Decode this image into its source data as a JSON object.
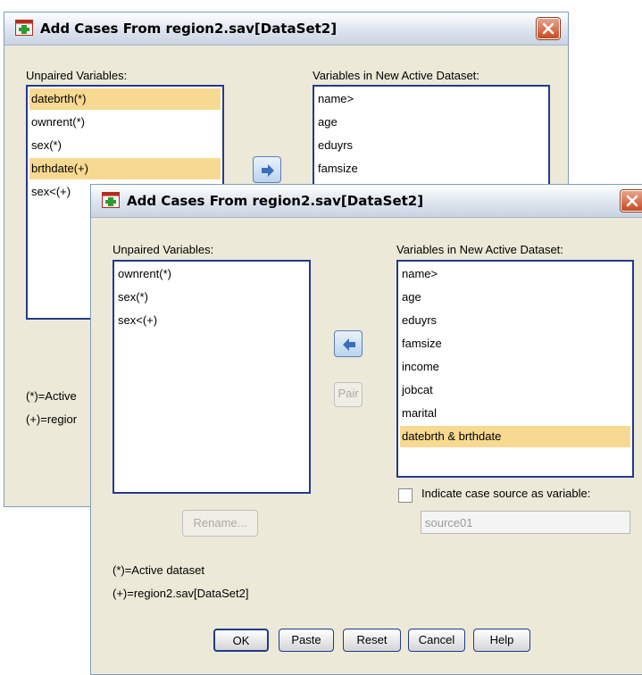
{
  "back_dialog": {
    "title": "Add Cases From region2.sav[DataSet2]",
    "unpaired_label": "Unpaired Variables:",
    "unpaired_items": [
      "datebrth(*)",
      "ownrent(*)",
      "sex(*)",
      "brthdate(+)",
      "sex<(+)"
    ],
    "new_label": "Variables in New Active Dataset:",
    "new_items": [
      "name>",
      "age",
      "eduyrs",
      "famsize"
    ],
    "legend_active": "(*)=Active",
    "legend_region": "(+)=regior"
  },
  "front_dialog": {
    "title": "Add Cases From region2.sav[DataSet2]",
    "unpaired_label": "Unpaired Variables:",
    "unpaired_items": [
      "ownrent(*)",
      "sex(*)",
      "sex<(+)"
    ],
    "new_label": "Variables in New Active Dataset:",
    "new_items": [
      "name>",
      "age",
      "eduyrs",
      "famsize",
      "income",
      "jobcat",
      "marital",
      "datebrth & brthdate"
    ],
    "pair_label": "Pair",
    "rename_label": "Rename...",
    "indicate_label": "Indicate case source as variable:",
    "source_value": "source01",
    "legend_active": "(*)=Active dataset",
    "legend_region": "(+)=region2.sav[DataSet2]",
    "buttons": {
      "ok": "OK",
      "paste": "Paste",
      "reset": "Reset",
      "cancel": "Cancel",
      "help": "Help"
    }
  },
  "colors": {
    "selected_row": "#f8d991",
    "list_border": "#233a8d",
    "dialog_bg": "#ECE9D8"
  }
}
